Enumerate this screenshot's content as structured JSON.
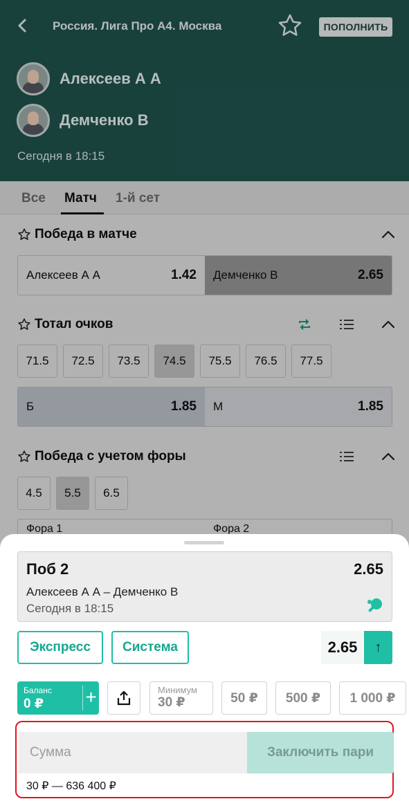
{
  "header": {
    "back_icon": "back-arrow-icon",
    "league": "Россия. Лига Про А4. Москва",
    "topup_label": "ПОПОЛНИТЬ",
    "player1": "Алексеев А А",
    "player2": "Демченко В",
    "start_time": "Сегодня в 18:15",
    "bg_color": "#1d4a45"
  },
  "tabs": [
    "Все",
    "Матч",
    "1-й сет"
  ],
  "match_win": {
    "title": "Победа в матче",
    "p1_label": "Алексеев А А",
    "p1_odd": "1.42",
    "p2_label": "Демченко В",
    "p2_odd": "2.65"
  },
  "total": {
    "title": "Тотал очков",
    "lines": [
      "71.5",
      "72.5",
      "73.5",
      "74.5",
      "75.5",
      "76.5",
      "77.5"
    ],
    "selected_line": "74.5",
    "over_label": "Б",
    "over_odd": "1.85",
    "under_label": "М",
    "under_odd": "1.85"
  },
  "handicap": {
    "title": "Победа с учетом форы",
    "lines": [
      "4.5",
      "5.5",
      "6.5"
    ],
    "selected_line": "5.5",
    "col1": "Фора 1",
    "col2": "Фора 2"
  },
  "betslip": {
    "selection": "Поб 2",
    "odd": "2.65",
    "match": "Алексеев А А – Демченко В",
    "date": "Сегодня в 18:15",
    "express_label": "Экспресс",
    "system_label": "Система",
    "total_odd": "2.65",
    "up_icon": "↑",
    "balance_label": "Баланс",
    "balance_value": "0 ₽",
    "min_label": "Минимум",
    "min_value": "30 ₽",
    "quick_amounts": [
      "50 ₽",
      "500 ₽",
      "1 000 ₽"
    ],
    "sum_placeholder": "Сумма",
    "place_label": "Заключить пари",
    "range": "30 ₽ — 636 400 ₽",
    "accent_color": "#1fbfa5",
    "highlight_color": "#e0161e"
  }
}
